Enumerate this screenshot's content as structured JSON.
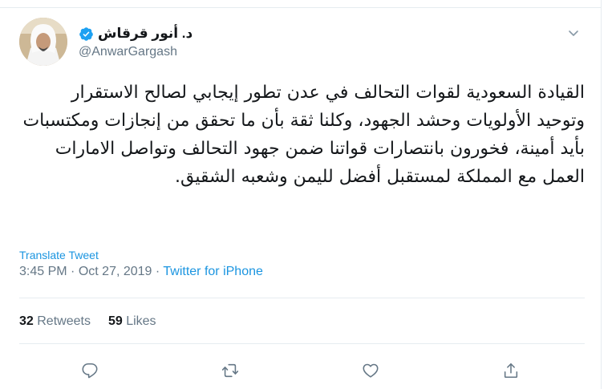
{
  "author": {
    "display_name": "د. أنور قرقاش",
    "handle": "@AnwarGargash",
    "verified": true
  },
  "tweet": {
    "text": "القيادة السعودية لقوات التحالف في عدن تطور إيجابي لصالح الاستقرار وتوحيد  الأولويات وحشد الجهود، وكلنا ثقة بأن ما تحقق من إنجازات ومكتسبات بأيد أمينة، فخورون بانتصارات قواتنا ضمن جهود التحالف وتواصل الامارات العمل مع المملكة لمستقبل أفضل لليمن وشعبه الشقيق.",
    "translate_label": "Translate Tweet",
    "time": "3:45 PM",
    "date": "Oct 27, 2019",
    "separator": "·",
    "source": "Twitter for iPhone"
  },
  "stats": {
    "retweets_count": "32",
    "retweets_label": "Retweets",
    "likes_count": "59",
    "likes_label": "Likes"
  },
  "colors": {
    "accent": "#1b95e0",
    "muted": "#657786",
    "verified": "#1da1f2"
  },
  "icons": [
    "chevron-down-icon",
    "reply-icon",
    "retweet-icon",
    "like-icon",
    "share-icon",
    "verified-badge-icon"
  ]
}
